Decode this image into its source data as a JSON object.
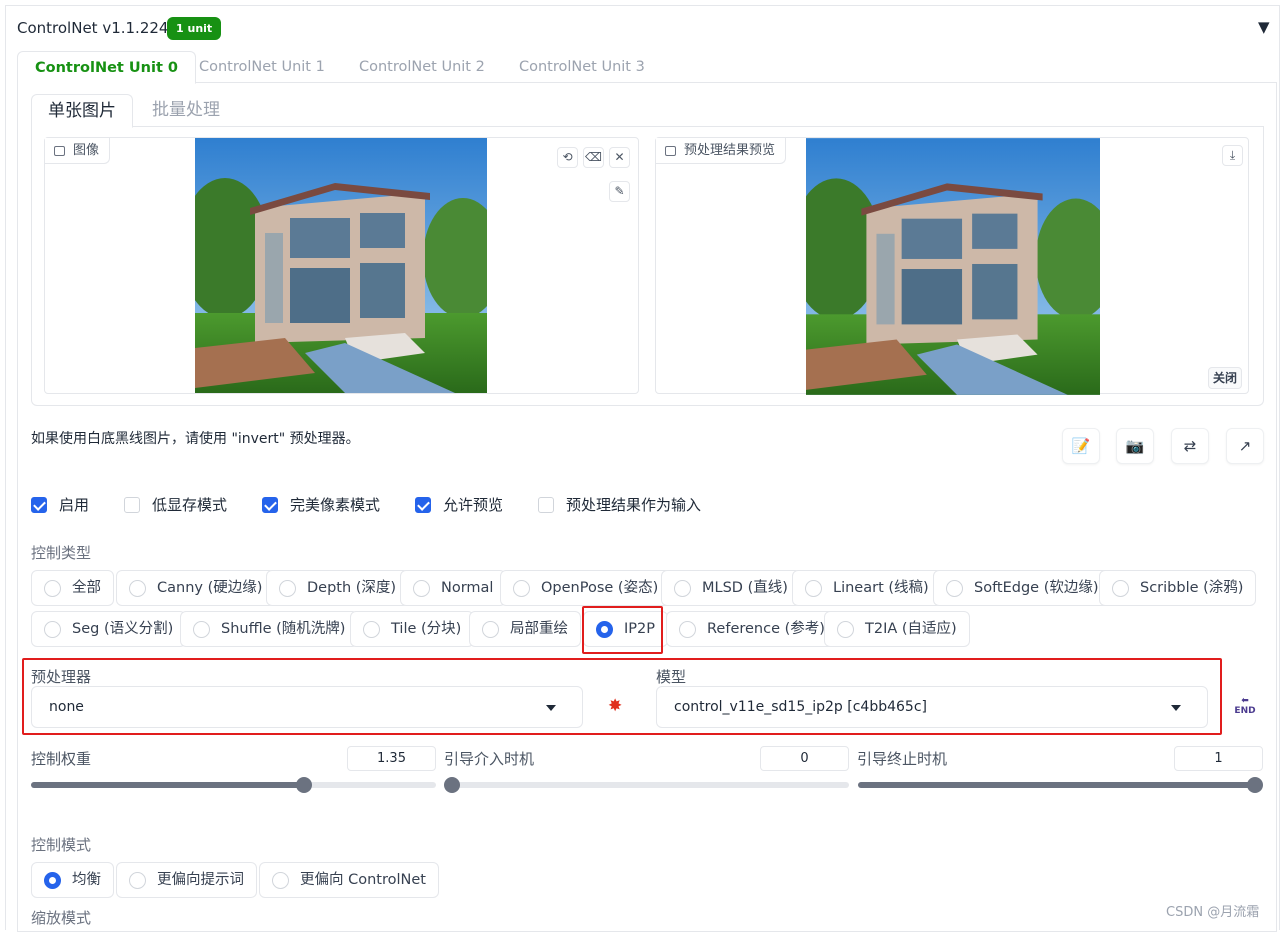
{
  "header": {
    "title": "ControlNet v1.1.224",
    "badge": "1 unit",
    "collapse": "▼"
  },
  "unit_tabs": [
    "ControlNet Unit 0",
    "ControlNet Unit 1",
    "ControlNet Unit 2",
    "ControlNet Unit 3"
  ],
  "mode_tabs": [
    "单张图片",
    "批量处理"
  ],
  "image_panel": {
    "label": "图像",
    "icon": "image-icon",
    "tools": [
      "undo-icon",
      "eraser-icon",
      "close-icon",
      "pen-icon"
    ]
  },
  "preview_panel": {
    "label": "预处理结果预览",
    "icon": "image-icon",
    "download_icon": "download-icon",
    "close_label": "关闭"
  },
  "hint": "如果使用白底黑线图片，请使用 \"invert\" 预处理器。",
  "icon_buttons": [
    "edit-icon",
    "camera-icon",
    "swap-icon",
    "send-icon"
  ],
  "checkboxes": [
    {
      "label": "启用",
      "checked": true
    },
    {
      "label": "低显存模式",
      "checked": false
    },
    {
      "label": "完美像素模式",
      "checked": true
    },
    {
      "label": "允许预览",
      "checked": true
    },
    {
      "label": "预处理结果作为输入",
      "checked": false
    }
  ],
  "control_type": {
    "label": "控制类型",
    "options": [
      "全部",
      "Canny (硬边缘)",
      "Depth (深度)",
      "Normal",
      "OpenPose (姿态)",
      "MLSD (直线)",
      "Lineart (线稿)",
      "SoftEdge (软边缘)",
      "Scribble (涂鸦)",
      "Seg (语义分割)",
      "Shuffle (随机洗牌)",
      "Tile (分块)",
      "局部重绘",
      "IP2P",
      "Reference (参考)",
      "T2IA (自适应)"
    ],
    "selected": "IP2P"
  },
  "preprocessor": {
    "label": "预处理器",
    "value": "none",
    "run_icon": "explosion-icon"
  },
  "model": {
    "label": "模型",
    "value": "control_v11e_sd15_ip2p [c4bb465c]",
    "refresh_icon": "end-arrow-icon"
  },
  "sliders": [
    {
      "label": "控制权重",
      "value": "1.35",
      "fraction": 0.675
    },
    {
      "label": "引导介入时机",
      "value": "0",
      "fraction": 0.0
    },
    {
      "label": "引导终止时机",
      "value": "1",
      "fraction": 1.0
    }
  ],
  "control_mode": {
    "label": "控制模式",
    "options": [
      "均衡",
      "更偏向提示词",
      "更偏向 ControlNet"
    ],
    "selected": "均衡"
  },
  "resize_mode": {
    "label": "缩放模式"
  },
  "watermark": "CSDN @月流霜",
  "colors": {
    "accent_green": "#179113",
    "accent_blue": "#2563eb",
    "highlight_red": "#e11d1d"
  }
}
